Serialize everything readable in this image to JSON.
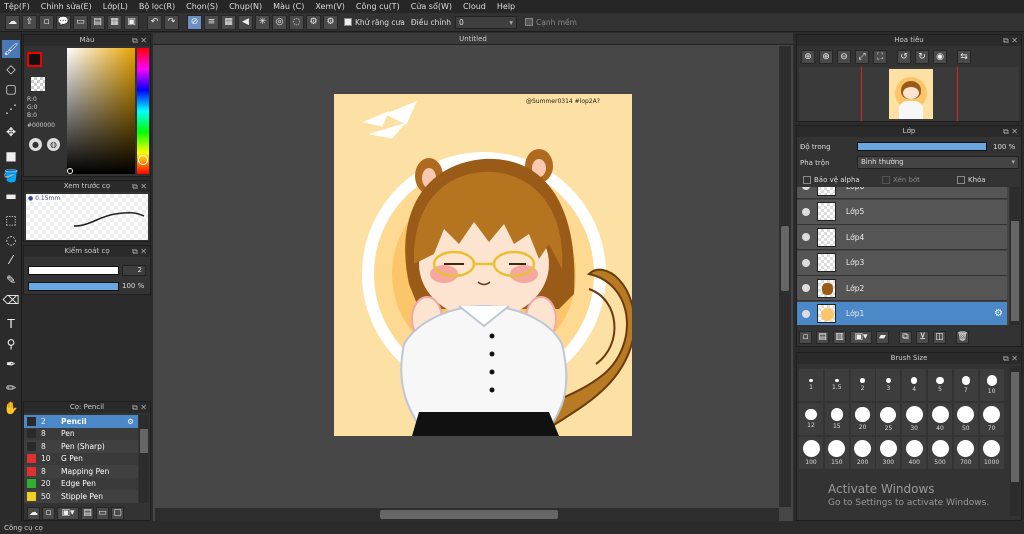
{
  "menu": [
    "Tệp(F)",
    "Chỉnh sửa(E)",
    "Lớp(L)",
    "Bộ lọc(R)",
    "Chọn(S)",
    "Chụp(N)",
    "Màu (C)",
    "Xem(V)",
    "Công cụ(T)",
    "Cửa sổ(W)",
    "Cloud",
    "Help"
  ],
  "toolbar": {
    "antialias_label": "Khử răng cưa",
    "adjust_label": "Điều chỉnh",
    "adjust_value": "0",
    "soft_edge_label": "Cạnh mềm"
  },
  "color_panel": {
    "title": "Màu",
    "r": "R:0",
    "g": "G:0",
    "b": "B:0",
    "hex": "#000000"
  },
  "brush_preview": {
    "title": "Xem trước cọ",
    "size": "0.15mm"
  },
  "brush_control": {
    "title": "Kiểm soát cọ",
    "size_value": "2",
    "opacity_value": "100 %",
    "opacity_fraction": 1.0
  },
  "brush_list": {
    "title": "Cọ: Pencil",
    "items": [
      {
        "size": "2",
        "name": "Pencil",
        "color": "#2a2a2a",
        "selected": true
      },
      {
        "size": "8",
        "name": "Pen",
        "color": "#2a2a2a"
      },
      {
        "size": "8",
        "name": "Pen (Sharp)",
        "color": "#2a2a2a"
      },
      {
        "size": "10",
        "name": "G Pen",
        "color": "#e03030"
      },
      {
        "size": "8",
        "name": "Mapping Pen",
        "color": "#e03030"
      },
      {
        "size": "20",
        "name": "Edge Pen",
        "color": "#30b030"
      },
      {
        "size": "50",
        "name": "Stipple Pen",
        "color": "#f0d020"
      }
    ]
  },
  "document": {
    "tab_title": "Untitled",
    "signature": "@Summer0314 #lop2A?"
  },
  "navigator": {
    "title": "Hoa tiêu"
  },
  "layer_panel": {
    "title": "Lớp",
    "opacity_label": "Độ trong",
    "opacity_value": "100 %",
    "opacity_fraction": 1.0,
    "blend_label": "Pha trộn",
    "blend_value": "Bình thường",
    "protect_alpha": "Bảo vệ alpha",
    "clipping": "Xén bớt",
    "lock": "Khóa",
    "layers": [
      "Lớp6",
      "Lớp5",
      "Lớp4",
      "Lớp3",
      "Lớp2",
      "Lớp1"
    ]
  },
  "brush_size_panel": {
    "title": "Brush Size",
    "sizes": [
      "1",
      "1.5",
      "2",
      "3",
      "4",
      "5",
      "7",
      "10",
      "12",
      "15",
      "20",
      "25",
      "30",
      "40",
      "50",
      "70",
      "100",
      "150",
      "200",
      "300",
      "400",
      "500",
      "700",
      "1000"
    ]
  },
  "watermark": {
    "line1": "Activate Windows",
    "line2": "Go to Settings to activate Windows."
  },
  "status": {
    "text": "Công cụ cọ"
  }
}
